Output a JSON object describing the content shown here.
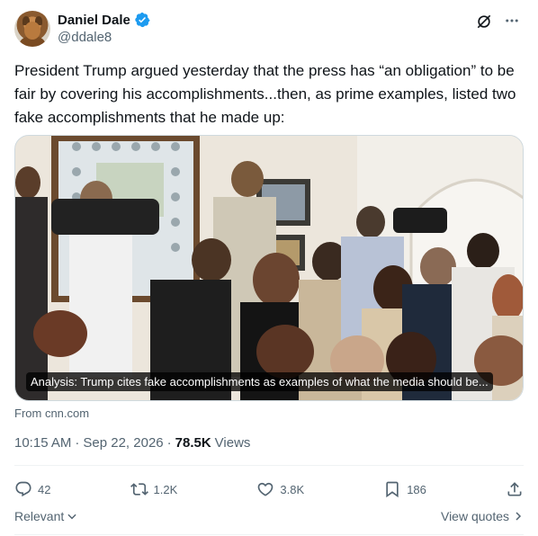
{
  "author": {
    "display_name": "Daniel Dale",
    "handle": "@ddale8",
    "verified": true
  },
  "tweet": {
    "text": "President Trump argued yesterday that the press has “an obligation” to be fair by covering his accomplishments...then, as prime examples, listed two fake accomplishments that he made up:"
  },
  "link_card": {
    "title": "Analysis: Trump cites fake accomplishments as examples of what the media should be...",
    "source": "From cnn.com"
  },
  "meta": {
    "time": "10:15 AM",
    "separator": "·",
    "date": "Sep 22, 2026",
    "separator2": "·",
    "views_count": "78.5K",
    "views_label": "Views"
  },
  "actions": {
    "replies": "42",
    "reposts": "1.2K",
    "likes": "3.8K",
    "bookmarks": "186"
  },
  "footer": {
    "relevant_label": "Relevant",
    "view_quotes_label": "View quotes"
  },
  "icons": {
    "verified": "verified-badge-icon",
    "grok": "grok-icon",
    "more": "more-icon",
    "reply": "reply-icon",
    "repost": "repost-icon",
    "like": "like-icon",
    "bookmark": "bookmark-icon",
    "share": "share-icon",
    "chevron_down": "chevron-down-icon",
    "chevron_right": "chevron-right-icon"
  },
  "colors": {
    "verified_blue": "#1d9bf0",
    "text_primary": "#0f1419",
    "text_secondary": "#536471"
  }
}
